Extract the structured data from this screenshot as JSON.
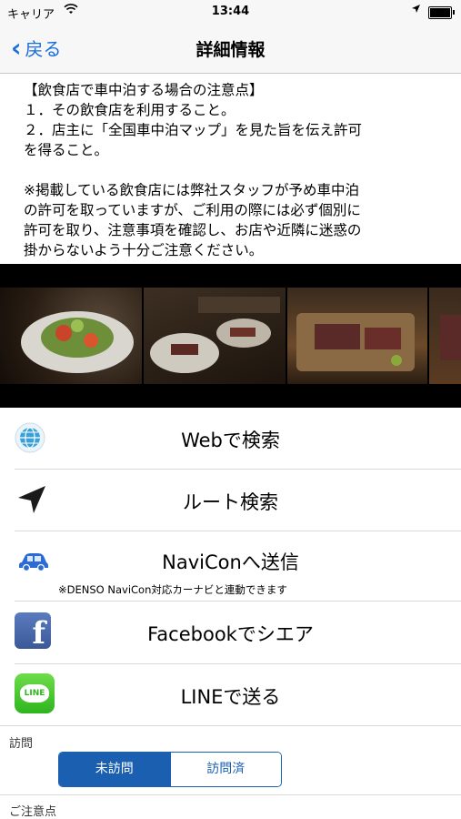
{
  "status_bar": {
    "carrier": "キャリア",
    "time": "13:44"
  },
  "nav": {
    "back_label": "戻る",
    "title": "詳細情報"
  },
  "notes": {
    "text": "【飲食店で車中泊する場合の注意点】\n１．その飲食店を利用すること。\n２．店主に「全国車中泊マップ」を見た旨を伝え許可\nを得ること。\n\n※掲載している飲食店には弊社スタッフが予め車中泊\nの許可を取っていますが、ご利用の際には必ず個別に\n許可を取り、注意事項を確認し、お店や近隣に迷惑の\n掛からないよう十分ご注意ください。"
  },
  "actions": [
    {
      "label": "Webで検索",
      "icon": "globe-icon"
    },
    {
      "label": "ルート検索",
      "icon": "location-arrow-icon"
    },
    {
      "label": "NaviConへ送信",
      "icon": "car-icon",
      "note": "※DENSO NaviCon対応カーナビと連動できます"
    },
    {
      "label": "Facebookでシエア",
      "icon": "facebook-icon",
      "icon_text": "f"
    },
    {
      "label": "LINEで送る",
      "icon": "line-icon",
      "icon_text": "LINE"
    }
  ],
  "visit": {
    "label": "訪問",
    "options": [
      "未訪問",
      "訪問済"
    ],
    "selected": "未訪問"
  },
  "notes_section_label": "ご注意点",
  "colors": {
    "accent": "#1a6ee0",
    "segment": "#1a5fb0",
    "facebook": "#3b5998",
    "line": "#2fb51f"
  }
}
